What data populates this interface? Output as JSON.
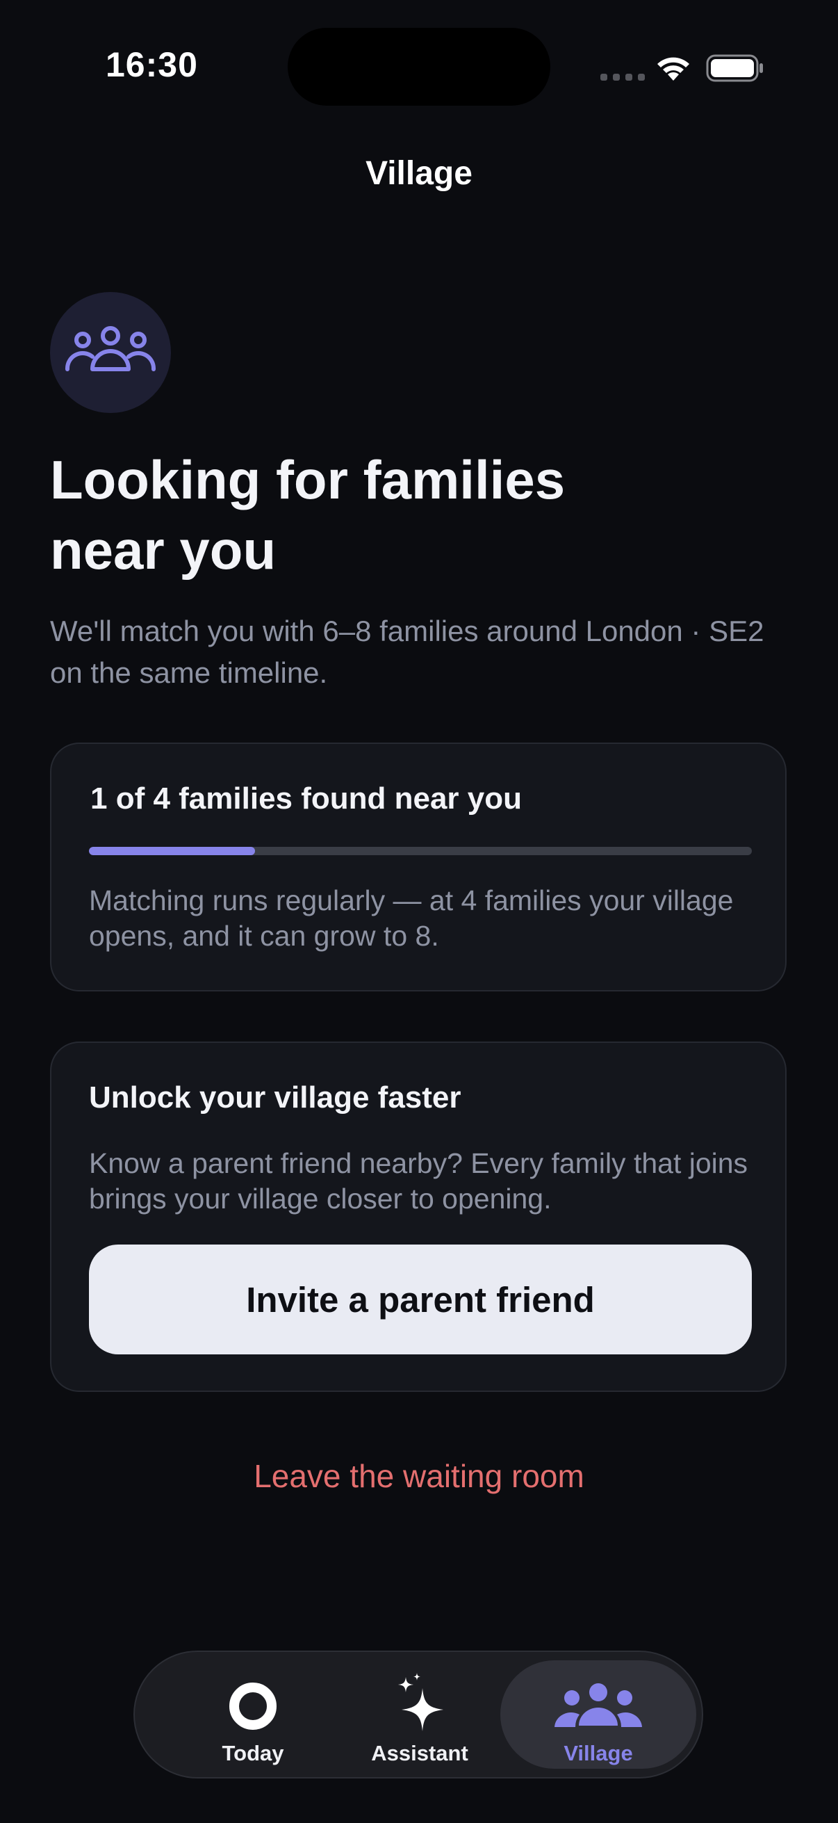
{
  "status_bar": {
    "time": "16:30"
  },
  "nav": {
    "title": "Village"
  },
  "hero": {
    "icon": "people-group-icon",
    "headline_line1": "Looking for families",
    "headline_line2": "near you",
    "subtitle": "We'll match you with 6–8 families around London · SE2 on the same timeline."
  },
  "progress_card": {
    "title": "1 of 4 families found near you",
    "found": 1,
    "target": 4,
    "progress_fraction": 0.25,
    "note": "Matching runs regularly — at 4 families your village opens, and it can grow to 8."
  },
  "invite_card": {
    "title": "Unlock your village faster",
    "text": "Know a parent friend nearby? Every family that joins brings your village closer to opening.",
    "button_label": "Invite a parent friend"
  },
  "leave_link": "Leave the waiting room",
  "tabbar": {
    "items": [
      {
        "label": "Today",
        "icon": "circle-ring-icon",
        "active": false
      },
      {
        "label": "Assistant",
        "icon": "sparkles-icon",
        "active": false
      },
      {
        "label": "Village",
        "icon": "people-group-icon",
        "active": true
      }
    ]
  },
  "colors": {
    "background": "#0b0c10",
    "card": "#14161c",
    "accent": "#8784ea",
    "danger": "#e46f6f",
    "muted_text": "#8e93a3"
  }
}
